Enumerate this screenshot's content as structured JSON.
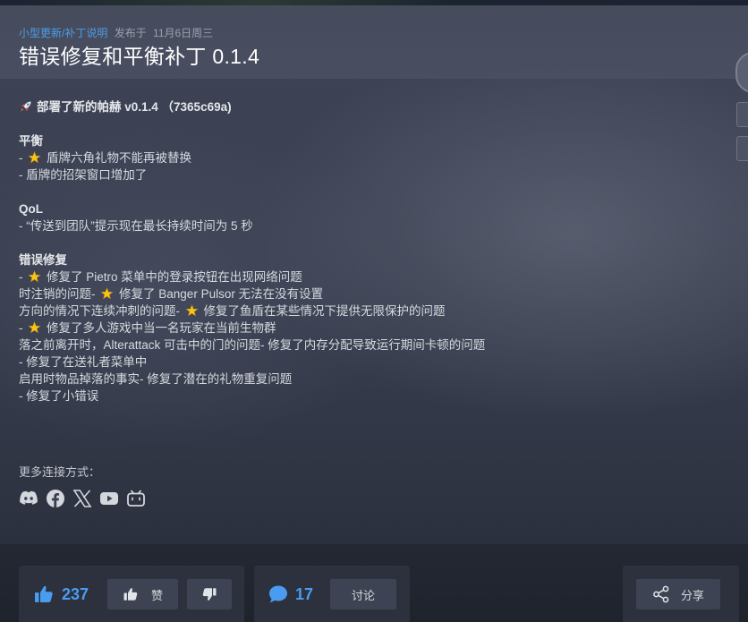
{
  "header": {
    "category": "小型更新/补丁说明",
    "posted_label": "发布于",
    "date": "11月6日周三",
    "title": "错误修复和平衡补丁 0.1.4"
  },
  "content": {
    "deploy_line": "部署了新的帕赫 v0.1.4 （7365c69a)",
    "balance_heading": "平衡",
    "balance_1": "盾牌六角礼物不能再被替换",
    "balance_2": "- 盾牌的招架窗口增加了",
    "qol_heading": "QoL",
    "qol_1": "- “传送到团队”提示现在最长持续时间为 5 秒",
    "bugfix_heading": "错误修复",
    "fix_1": "修复了 Pietro 菜单中的登录按钮在出现网络问题",
    "fix_2a": "时注销的问题-",
    "fix_2b": "修复了 Banger Pulsor 无法在没有设置",
    "fix_3a": "方向的情况下连续冲刺的问题-",
    "fix_3b": "修复了鱼盾在某些情况下提供无限保护的问题",
    "fix_4": "修复了多人游戏中当一名玩家在当前生物群",
    "fix_5": "落之前离开时，Alterattack 可击中的门的问题- 修复了内存分配导致运行期间卡顿的问题",
    "fix_6": "- 修复了在送礼者菜单中",
    "fix_7": "启用时物品掉落的事实- 修复了潜在的礼物重复问题",
    "fix_8": "- 修复了小错误",
    "dash": "-"
  },
  "footer": {
    "more_label": "更多连接方式：",
    "social": [
      "discord-icon",
      "facebook-icon",
      "x-twitter-icon",
      "youtube-icon",
      "bilibili-icon"
    ]
  },
  "actions": {
    "like_count": "237",
    "like_label": "赞",
    "comment_count": "17",
    "discuss_label": "讨论",
    "share_label": "分享"
  },
  "colors": {
    "accent": "#4a9cf0",
    "category_link": "#4c9ce8",
    "star": "#f5c518"
  }
}
